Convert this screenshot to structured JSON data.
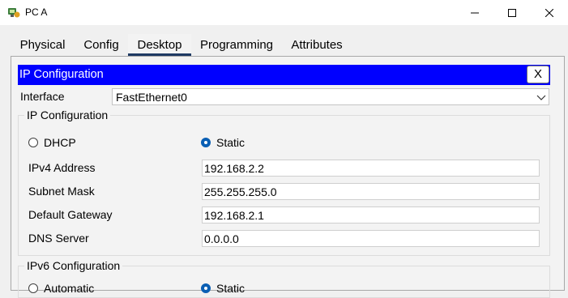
{
  "window": {
    "title": "PC A"
  },
  "tabs": [
    {
      "label": "Physical"
    },
    {
      "label": "Config"
    },
    {
      "label": "Desktop"
    },
    {
      "label": "Programming"
    },
    {
      "label": "Attributes"
    }
  ],
  "active_tab": "Desktop",
  "ip_config": {
    "header_title": "IP Configuration",
    "close_label": "X",
    "interface_label": "Interface",
    "interface_value": "FastEthernet0",
    "ipv4_group_title": "IP Configuration",
    "dhcp_label": "DHCP",
    "static_label": "Static",
    "mode_selected": "Static",
    "fields": [
      {
        "label": "IPv4 Address",
        "value": "192.168.2.2"
      },
      {
        "label": "Subnet Mask",
        "value": "255.255.255.0"
      },
      {
        "label": "Default Gateway",
        "value": "192.168.2.1"
      },
      {
        "label": "DNS Server",
        "value": "0.0.0.0"
      }
    ],
    "ipv6_group_title": "IPv6 Configuration",
    "ipv6_auto_label": "Automatic",
    "ipv6_static_label": "Static",
    "ipv6_mode_selected": "Static"
  },
  "colors": {
    "header_bg": "#0000ff",
    "radio_selected": "#0a5fb4",
    "active_tab_underline": "#1f3a63"
  },
  "icons": [
    "app-icon",
    "minimize-icon",
    "maximize-icon",
    "close-icon",
    "chevron-down-icon"
  ]
}
